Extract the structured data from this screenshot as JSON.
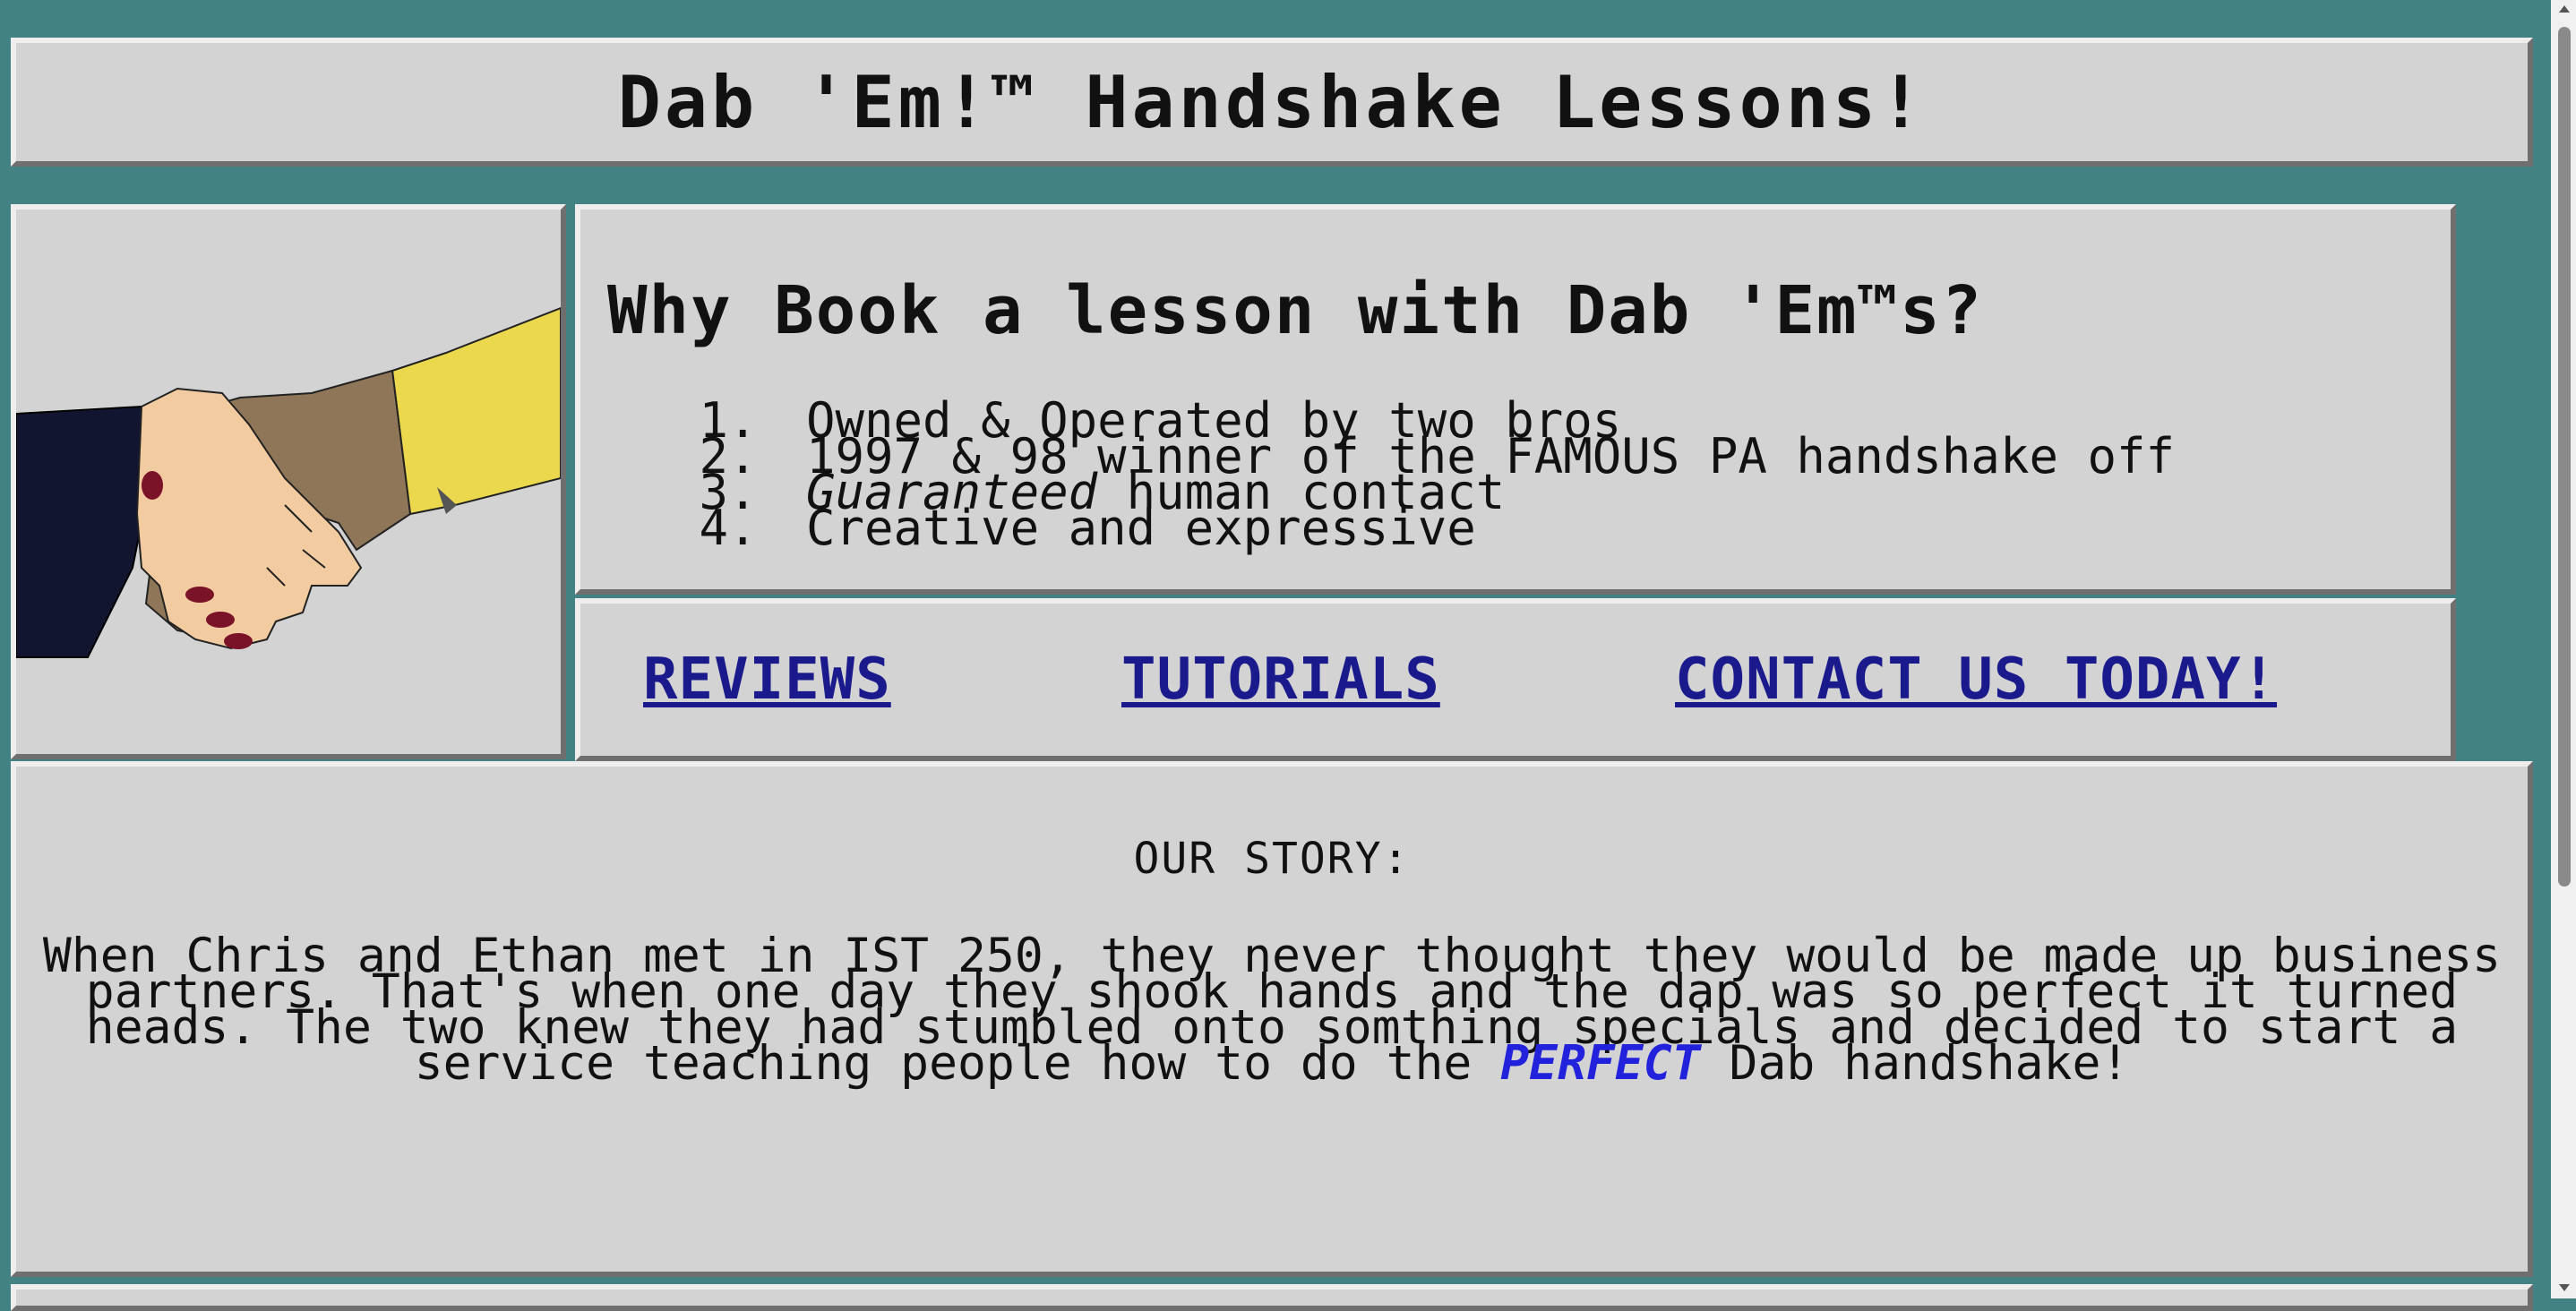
{
  "header": {
    "title": "Dab 'Em!™ Handshake Lessons!"
  },
  "hero_image": {
    "icon": "handshake-illustration"
  },
  "why": {
    "title": "Why Book a lesson with Dab 'Em™s?",
    "reasons": [
      {
        "text": "Owned & Operated by two bros"
      },
      {
        "text": "1997 & 98 winner of the FAMOUS PA handshake off"
      },
      {
        "italic": "Guaranteed",
        "text": " human contact"
      },
      {
        "text": "Creative and expressive"
      }
    ]
  },
  "nav": {
    "reviews": "REVIEWS",
    "tutorials": "TUTORIALS",
    "contact": "CONTACT US TODAY!"
  },
  "story": {
    "title": "OUR STORY:",
    "text_before": "When Chris and Ethan met in IST 250, they never thought they would be made up business partners. That's when one day they shook hands and the dap was so perfect it turned heads. The two knew they had stumbled onto somthing specials and decided to start a service teaching people how to do the ",
    "emphasis": "PERFECT",
    "text_after": " Dab handshake!"
  },
  "colors": {
    "background": "#438283",
    "panel": "#d3d3d3",
    "link": "#1a1a8c",
    "emphasis": "#2222dd"
  }
}
